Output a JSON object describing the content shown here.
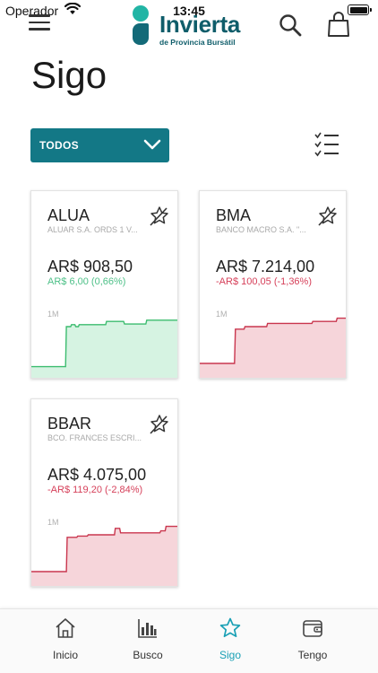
{
  "status_bar": {
    "carrier": "Operador",
    "time": "13:45"
  },
  "brand": {
    "name": "Invierta",
    "tagline": "de Provincia Bursátil"
  },
  "page": {
    "title": "Sigo"
  },
  "filter": {
    "selected": "TODOS"
  },
  "cards": [
    {
      "ticker": "ALUA",
      "description": "ALUAR S.A. ORDS 1 V...",
      "price": "AR$ 908,50",
      "change": "AR$ 6,00 (0,66%)",
      "trend": "up",
      "period": "1M",
      "line_color": "#3cbc6f",
      "fill_color": "#d6f3e2",
      "series": [
        0.2,
        0.2,
        0.2,
        0.2,
        0.2,
        0.2,
        0.2,
        0.2,
        0.2,
        0.2,
        0.2,
        0.2,
        0.2,
        0.2,
        0.2,
        0.2,
        0.2,
        0.2,
        0.2,
        0.2,
        0.2,
        0.2,
        0.2,
        0.2,
        0.2,
        0.2,
        0.2,
        0.2,
        0.2,
        0.2,
        0.2,
        0.2,
        0.2,
        0.2,
        0.2,
        0.2,
        0.2,
        0.2,
        0.2,
        0.2,
        0.2,
        0.82,
        0.82,
        0.82,
        0.82,
        0.82,
        0.82,
        0.85,
        0.85,
        0.85,
        0.85,
        0.85,
        0.82,
        0.82,
        0.82,
        0.82,
        0.85,
        0.85,
        0.85,
        0.85,
        0.85,
        0.85,
        0.85,
        0.85,
        0.85,
        0.85,
        0.85,
        0.85,
        0.85,
        0.85,
        0.85,
        0.85,
        0.85,
        0.85,
        0.85,
        0.85,
        0.85,
        0.85,
        0.85,
        0.85,
        0.85,
        0.85,
        0.85,
        0.85,
        0.85,
        0.85,
        0.85,
        0.85,
        0.9,
        0.9,
        0.9,
        0.9,
        0.9,
        0.9,
        0.9,
        0.9,
        0.9,
        0.9,
        0.9,
        0.9,
        0.9,
        0.9,
        0.9,
        0.9,
        0.9,
        0.9,
        0.9,
        0.9,
        0.9,
        0.86,
        0.86,
        0.86,
        0.86,
        0.86,
        0.86,
        0.86,
        0.86,
        0.86,
        0.86,
        0.86,
        0.86,
        0.86,
        0.86,
        0.86,
        0.86,
        0.86,
        0.86,
        0.86,
        0.86,
        0.86,
        0.86,
        0.86,
        0.86,
        0.86,
        0.86,
        0.92,
        0.92,
        0.92,
        0.92,
        0.92,
        0.92,
        0.92,
        0.92,
        0.92,
        0.92,
        0.92,
        0.92,
        0.92,
        0.92,
        0.92,
        0.92,
        0.92,
        0.92,
        0.92,
        0.92,
        0.92,
        0.92,
        0.92,
        0.92,
        0.92,
        0.92,
        0.92,
        0.92,
        0.92,
        0.92,
        0.92,
        0.92,
        0.92,
        0.92,
        0.92,
        0.92,
        0.92,
        0.92,
        0.92
      ]
    },
    {
      "ticker": "BMA",
      "description": "BANCO MACRO S.A. \"...",
      "price": "AR$ 7.214,00",
      "change": "-AR$ 100,05 (-1,36%)",
      "trend": "down",
      "period": "1M",
      "line_color": "#c9364e",
      "fill_color": "#f6d5da",
      "series": [
        0.25,
        0.25,
        0.25,
        0.25,
        0.25,
        0.25,
        0.25,
        0.25,
        0.25,
        0.25,
        0.25,
        0.25,
        0.25,
        0.25,
        0.25,
        0.25,
        0.25,
        0.25,
        0.25,
        0.25,
        0.25,
        0.25,
        0.25,
        0.25,
        0.25,
        0.25,
        0.25,
        0.25,
        0.25,
        0.25,
        0.25,
        0.25,
        0.25,
        0.25,
        0.25,
        0.25,
        0.25,
        0.25,
        0.25,
        0.25,
        0.25,
        0.78,
        0.78,
        0.78,
        0.78,
        0.78,
        0.78,
        0.78,
        0.78,
        0.78,
        0.78,
        0.78,
        0.82,
        0.82,
        0.82,
        0.82,
        0.82,
        0.82,
        0.82,
        0.82,
        0.82,
        0.82,
        0.82,
        0.82,
        0.82,
        0.82,
        0.82,
        0.82,
        0.82,
        0.82,
        0.82,
        0.82,
        0.82,
        0.82,
        0.82,
        0.82,
        0.82,
        0.82,
        0.87,
        0.87,
        0.87,
        0.87,
        0.87,
        0.87,
        0.87,
        0.87,
        0.87,
        0.87,
        0.87,
        0.87,
        0.87,
        0.87,
        0.87,
        0.87,
        0.87,
        0.87,
        0.87,
        0.87,
        0.87,
        0.87,
        0.87,
        0.87,
        0.87,
        0.87,
        0.87,
        0.87,
        0.87,
        0.87,
        0.87,
        0.87,
        0.87,
        0.87,
        0.87,
        0.87,
        0.87,
        0.87,
        0.87,
        0.87,
        0.87,
        0.87,
        0.87,
        0.87,
        0.87,
        0.87,
        0.87,
        0.87,
        0.87,
        0.87,
        0.87,
        0.87,
        0.9,
        0.9,
        0.9,
        0.9,
        0.9,
        0.9,
        0.9,
        0.9,
        0.9,
        0.9,
        0.9,
        0.9,
        0.9,
        0.9,
        0.9,
        0.9,
        0.9,
        0.9,
        0.9,
        0.9,
        0.9,
        0.9,
        0.9,
        0.9,
        0.9,
        0.9,
        0.9,
        0.9,
        0.95,
        0.95,
        0.95,
        0.95,
        0.95,
        0.95,
        0.95,
        0.95,
        0.95,
        0.95,
        0.95,
        0.95,
        0.95
      ]
    },
    {
      "ticker": "BBAR",
      "description": "BCO. FRANCES ESCRI...",
      "price": "AR$ 4.075,00",
      "change": "-AR$ 119,20 (-2,84%)",
      "trend": "down",
      "period": "1M",
      "line_color": "#c9364e",
      "fill_color": "#f6d5da",
      "series": [
        0.25,
        0.25,
        0.25,
        0.25,
        0.25,
        0.25,
        0.25,
        0.25,
        0.25,
        0.25,
        0.25,
        0.25,
        0.25,
        0.25,
        0.25,
        0.25,
        0.25,
        0.25,
        0.25,
        0.25,
        0.25,
        0.25,
        0.25,
        0.25,
        0.25,
        0.25,
        0.25,
        0.25,
        0.25,
        0.25,
        0.25,
        0.25,
        0.25,
        0.25,
        0.25,
        0.25,
        0.25,
        0.25,
        0.25,
        0.25,
        0.25,
        0.78,
        0.78,
        0.78,
        0.78,
        0.78,
        0.78,
        0.78,
        0.78,
        0.78,
        0.78,
        0.78,
        0.78,
        0.8,
        0.8,
        0.8,
        0.8,
        0.8,
        0.8,
        0.8,
        0.8,
        0.8,
        0.8,
        0.8,
        0.8,
        0.82,
        0.82,
        0.82,
        0.82,
        0.82,
        0.82,
        0.82,
        0.82,
        0.82,
        0.82,
        0.82,
        0.82,
        0.82,
        0.82,
        0.82,
        0.82,
        0.82,
        0.82,
        0.82,
        0.82,
        0.82,
        0.82,
        0.82,
        0.82,
        0.82,
        0.82,
        0.82,
        0.82,
        0.82,
        0.82,
        0.82,
        0.92,
        0.92,
        0.92,
        0.92,
        0.92,
        0.92,
        0.85,
        0.85,
        0.85,
        0.85,
        0.85,
        0.85,
        0.85,
        0.85,
        0.85,
        0.85,
        0.85,
        0.85,
        0.85,
        0.85,
        0.85,
        0.85,
        0.85,
        0.85,
        0.85,
        0.85,
        0.85,
        0.85,
        0.85,
        0.85,
        0.85,
        0.85,
        0.85,
        0.85,
        0.85,
        0.85,
        0.85,
        0.85,
        0.85,
        0.85,
        0.85,
        0.85,
        0.85,
        0.85,
        0.85,
        0.85,
        0.85,
        0.85,
        0.85,
        0.85,
        0.85,
        0.85,
        0.88,
        0.88,
        0.88,
        0.88,
        0.88,
        0.88,
        0.95,
        0.95,
        0.95,
        0.95,
        0.95,
        0.95,
        0.95,
        0.95,
        0.95,
        0.95,
        0.95,
        0.95,
        0.95,
        0.95,
        0.95,
        0.95
      ]
    }
  ],
  "bottom_nav": {
    "items": [
      {
        "label": "Inicio",
        "icon": "home-icon",
        "active": false
      },
      {
        "label": "Busco",
        "icon": "bar-chart-icon",
        "active": false
      },
      {
        "label": "Sigo",
        "icon": "star-icon",
        "active": true
      },
      {
        "label": "Tengo",
        "icon": "wallet-icon",
        "active": false
      }
    ]
  },
  "colors": {
    "brand_teal": "#137886",
    "active_tab": "#1aa0b5",
    "up": "#4ec088",
    "down": "#d6405a"
  }
}
